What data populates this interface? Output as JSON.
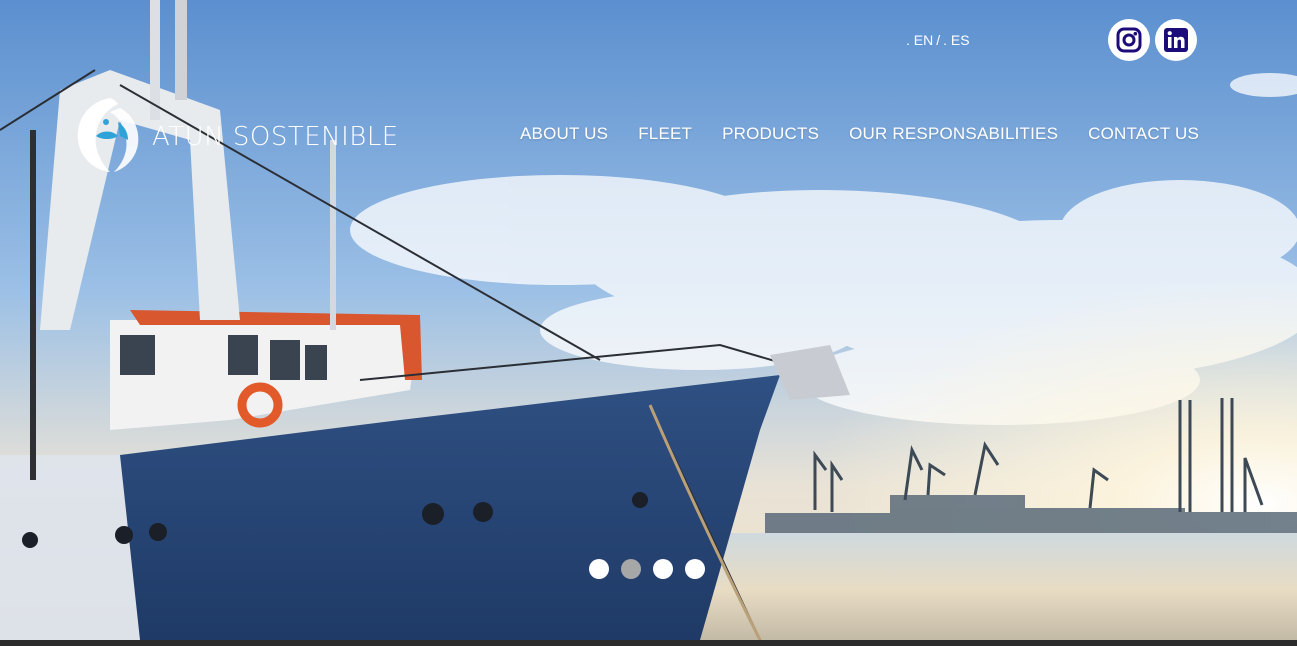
{
  "brand": {
    "name": "ATUN SOSTENIBLE"
  },
  "language": {
    "options": [
      ". EN",
      "/",
      ". ES"
    ]
  },
  "social": [
    {
      "name": "instagram-icon",
      "color": "#1c0c7a"
    },
    {
      "name": "linkedin-icon",
      "color": "#1c0c7a"
    }
  ],
  "nav": {
    "items": [
      {
        "label": "ABOUT US"
      },
      {
        "label": "FLEET"
      },
      {
        "label": "PRODUCTS"
      },
      {
        "label": "OUR RESPONSABILITIES"
      },
      {
        "label": "CONTACT US"
      }
    ]
  },
  "slider": {
    "count": 4,
    "active_index": 1
  },
  "colors": {
    "sky_top": "#6f9fd4",
    "hull": "#2a4a7a",
    "accent": "#1c0c7a"
  }
}
